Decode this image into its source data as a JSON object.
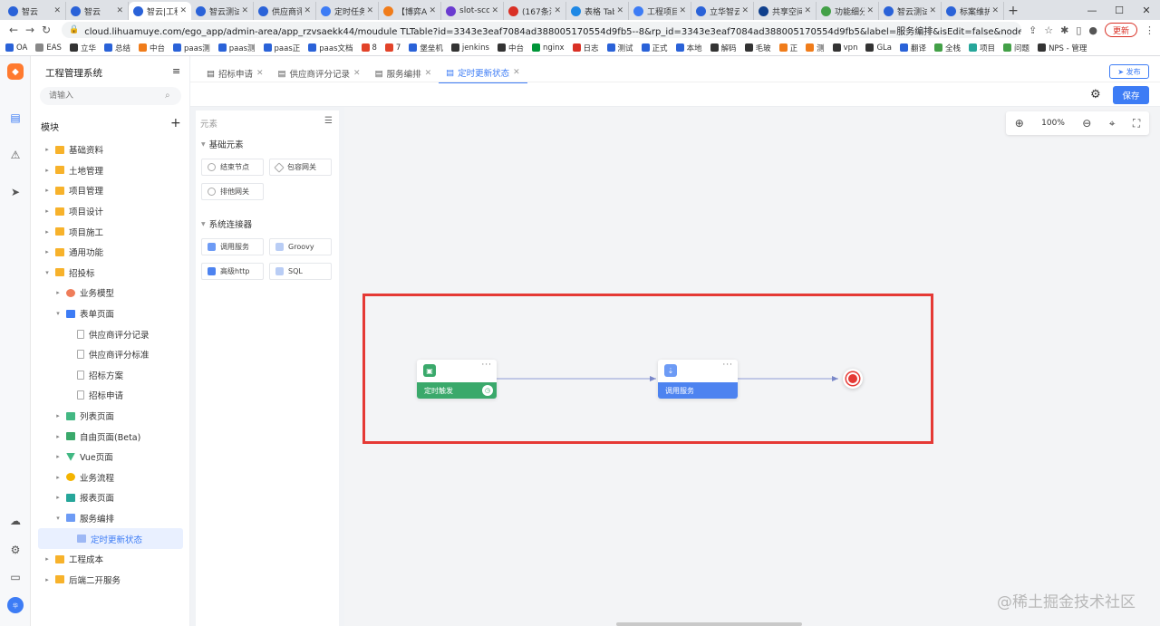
{
  "browser": {
    "tabs": [
      {
        "label": "智云",
        "color": "#2a62d8"
      },
      {
        "label": "智云",
        "color": "#2a62d8"
      },
      {
        "label": "智云|工程",
        "color": "#2a62d8",
        "active": true
      },
      {
        "label": "智云测试",
        "color": "#2a62d8"
      },
      {
        "label": "供应商评",
        "color": "#2a62d8"
      },
      {
        "label": "定时任务",
        "color": "#3d7cf5"
      },
      {
        "label": "【博弈Ai",
        "color": "#f07c1a"
      },
      {
        "label": "slot-sco",
        "color": "#6a3bd0"
      },
      {
        "label": "(167条消",
        "color": "#d93025"
      },
      {
        "label": "表格 Tab",
        "color": "#1e88e5"
      },
      {
        "label": "工程项目",
        "color": "#3d7cf5"
      },
      {
        "label": "立华智云",
        "color": "#2a62d8"
      },
      {
        "label": "共享空间",
        "color": "#0f3f8c"
      },
      {
        "label": "功能细分",
        "color": "#43a047"
      },
      {
        "label": "智云测试",
        "color": "#2a62d8"
      },
      {
        "label": "标案维护",
        "color": "#2a62d8"
      }
    ],
    "url": "cloud.lihuamuye.com/ego_app/admin-area/app_rzvsaekk44/moudule TLTable?id=3343e3eaf7084ad388005170554d9fb5--8&rp_id=3343e3eaf7084ad388005170554d9fb5&label=服务编排&isEdit=false&nodeValue=&icon_type=img&base_res...",
    "update_label": "更新",
    "bookmarks": [
      {
        "label": "OA",
        "color": "#2a62d8"
      },
      {
        "label": "EAS",
        "color": "#888888"
      },
      {
        "label": "立华",
        "color": "#333333"
      },
      {
        "label": "总结",
        "color": "#2a62d8"
      },
      {
        "label": "中台",
        "color": "#f07c1a"
      },
      {
        "label": "paas测",
        "color": "#2a62d8"
      },
      {
        "label": "paas测",
        "color": "#2a62d8"
      },
      {
        "label": "paas正",
        "color": "#2a62d8"
      },
      {
        "label": "paas文档",
        "color": "#2a62d8"
      },
      {
        "label": "8",
        "color": "#e24329"
      },
      {
        "label": "7",
        "color": "#e24329"
      },
      {
        "label": "堡垒机",
        "color": "#2a62d8"
      },
      {
        "label": "jenkins",
        "color": "#333333"
      },
      {
        "label": "中台",
        "color": "#333333"
      },
      {
        "label": "nginx",
        "color": "#009639"
      },
      {
        "label": "日志",
        "color": "#d93025"
      },
      {
        "label": "测试",
        "color": "#2a62d8"
      },
      {
        "label": "正式",
        "color": "#2a62d8"
      },
      {
        "label": "本地",
        "color": "#2a62d8"
      },
      {
        "label": "解码",
        "color": "#333333"
      },
      {
        "label": "毛玻",
        "color": "#333333"
      },
      {
        "label": "正",
        "color": "#f07c1a"
      },
      {
        "label": "测",
        "color": "#f07c1a"
      },
      {
        "label": "vpn",
        "color": "#333333"
      },
      {
        "label": "GLa",
        "color": "#333333"
      },
      {
        "label": "翻译",
        "color": "#2a62d8"
      },
      {
        "label": "全栈",
        "color": "#43a047"
      },
      {
        "label": "项目",
        "color": "#26a69a"
      },
      {
        "label": "问题",
        "color": "#43a047"
      },
      {
        "label": "NPS - 管理",
        "color": "#333333"
      }
    ]
  },
  "sidebar": {
    "title": "工程管理系统",
    "search_placeholder": "请输入",
    "module_label": "模块",
    "items": [
      {
        "label": "基础资料",
        "level": 0,
        "type": "folder",
        "caret": "▸"
      },
      {
        "label": "土地管理",
        "level": 0,
        "type": "folder",
        "caret": "▸"
      },
      {
        "label": "项目管理",
        "level": 0,
        "type": "folder",
        "caret": "▸"
      },
      {
        "label": "项目设计",
        "level": 0,
        "type": "folder",
        "caret": "▸"
      },
      {
        "label": "项目施工",
        "level": 0,
        "type": "folder",
        "caret": "▸"
      },
      {
        "label": "通用功能",
        "level": 0,
        "type": "folder",
        "caret": "▸"
      },
      {
        "label": "招投标",
        "level": 0,
        "type": "folder",
        "caret": "▾"
      },
      {
        "label": "业务模型",
        "level": 1,
        "type": "model",
        "caret": "▸"
      },
      {
        "label": "表单页面",
        "level": 1,
        "type": "form",
        "caret": "▾"
      },
      {
        "label": "供应商评分记录",
        "level": 2,
        "type": "page",
        "caret": ""
      },
      {
        "label": "供应商评分标准",
        "level": 2,
        "type": "page",
        "caret": ""
      },
      {
        "label": "招标方案",
        "level": 2,
        "type": "page",
        "caret": ""
      },
      {
        "label": "招标申请",
        "level": 2,
        "type": "page",
        "caret": ""
      },
      {
        "label": "列表页面",
        "level": 1,
        "type": "list",
        "caret": "▸"
      },
      {
        "label": "自由页面(Beta)",
        "level": 1,
        "type": "free",
        "caret": "▸"
      },
      {
        "label": "Vue页面",
        "level": 1,
        "type": "vue",
        "caret": "▸"
      },
      {
        "label": "业务流程",
        "level": 1,
        "type": "flow",
        "caret": "▸"
      },
      {
        "label": "报表页面",
        "level": 1,
        "type": "report",
        "caret": "▸"
      },
      {
        "label": "服务编排",
        "level": 1,
        "type": "orch",
        "caret": "▾"
      },
      {
        "label": "定时更新状态",
        "level": 2,
        "type": "orchpage",
        "caret": "",
        "selected": true
      },
      {
        "label": "工程成本",
        "level": 0,
        "type": "folder",
        "caret": "▸"
      },
      {
        "label": "后端二开服务",
        "level": 0,
        "type": "folder",
        "caret": "▸"
      }
    ]
  },
  "page_tabs": [
    {
      "label": "招标申请",
      "active": false
    },
    {
      "label": "供应商评分记录",
      "active": false
    },
    {
      "label": "服务编排",
      "active": false
    },
    {
      "label": "定时更新状态",
      "active": true
    }
  ],
  "header": {
    "publish_label": "发布",
    "save_label": "保存"
  },
  "palette": {
    "title": "元素",
    "sections": [
      {
        "title": "基础元素",
        "items": [
          "结束节点",
          "包容网关",
          "排他网关"
        ]
      },
      {
        "title": "系统连接器",
        "items": [
          "调用服务",
          "Groovy",
          "高级http",
          "SQL"
        ]
      }
    ]
  },
  "canvas": {
    "zoom": "100%",
    "nodes": {
      "trigger": {
        "label": "定时触发",
        "color": "#3aa96b"
      },
      "service": {
        "label": "调用服务",
        "color": "#4d83f0"
      },
      "end_color": "#e53935"
    }
  },
  "watermark": "@稀土掘金技术社区"
}
